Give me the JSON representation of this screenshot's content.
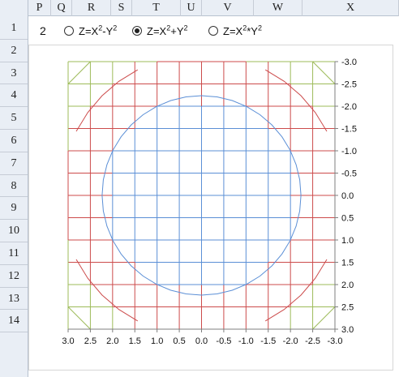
{
  "columns": [
    "P",
    "Q",
    "R",
    "S",
    "T",
    "U",
    "V",
    "W",
    "X"
  ],
  "rows": [
    "1",
    "2",
    "3",
    "4",
    "5",
    "6",
    "7",
    "8",
    "9",
    "10",
    "11",
    "12",
    "13",
    "14"
  ],
  "controls": {
    "value": "2",
    "options": [
      {
        "base": "Z=X",
        "exp1": "2",
        "op": "-Y",
        "exp2": "2",
        "selected": false
      },
      {
        "base": "Z=X",
        "exp1": "2",
        "op": "+Y",
        "exp2": "2",
        "selected": true
      },
      {
        "base": "Z=X",
        "exp1": "2",
        "op": "*Y",
        "exp2": "2",
        "selected": false
      }
    ]
  },
  "chart_data": {
    "type": "line",
    "x_ticks": [
      "3.0",
      "2.5",
      "2.0",
      "1.5",
      "1.0",
      "0.5",
      "0.0",
      "-0.5",
      "-1.0",
      "-1.5",
      "-2.0",
      "-2.5",
      "-3.0"
    ],
    "y_ticks": [
      "-3.0",
      "-2.5",
      "-2.0",
      "-1.5",
      "-1.0",
      "-0.5",
      "0.0",
      "0.5",
      "1.0",
      "1.5",
      "2.0",
      "2.5",
      "3.0"
    ],
    "xlim": [
      3.0,
      -3.0
    ],
    "ylim": [
      -3.0,
      3.0
    ],
    "x_reversed": true,
    "y_reversed": true,
    "grid_step": 0.5,
    "grid": true,
    "surface": "Z=X^2+Y^2",
    "bands": [
      {
        "range": "0-5",
        "color": "#5b8fd6",
        "contour_radius": 2.236
      },
      {
        "range": "5-10",
        "color": "#cc4b4b",
        "contour_radius": 3.162
      },
      {
        "range": "10-15",
        "color": "#9dbb59"
      },
      {
        "range": "15-20",
        "color": "#8064a2"
      }
    ],
    "axis_color": "#7f7f7f"
  }
}
